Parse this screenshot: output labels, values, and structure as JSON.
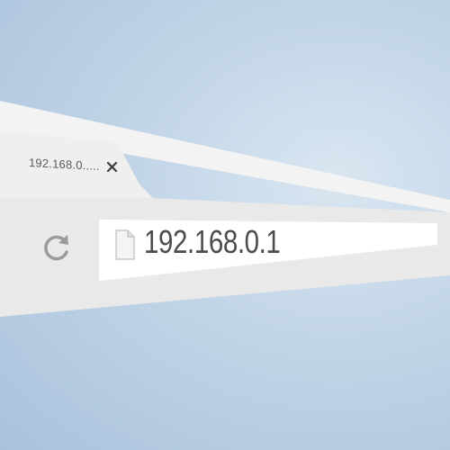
{
  "tab": {
    "title": "192.168.0.....",
    "close_icon": "close-icon"
  },
  "toolbar": {
    "reload_icon": "reload-icon"
  },
  "address_bar": {
    "page_icon": "page-icon",
    "url": "192.168.0.1"
  },
  "colors": {
    "background": "#c3d6e8",
    "chrome": "#ececec",
    "address_field": "#ffffff",
    "text": "#4d4d4d"
  }
}
